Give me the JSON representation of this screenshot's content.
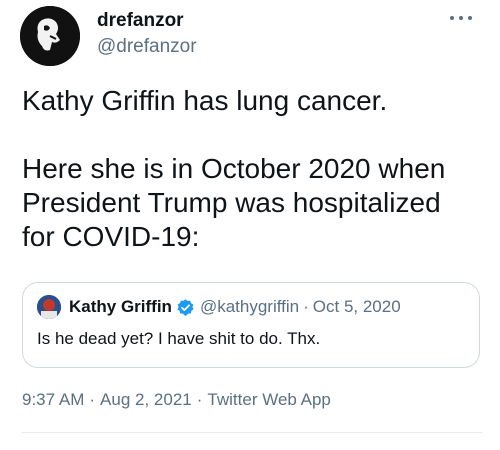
{
  "author": {
    "display_name": "drefanzor",
    "handle": "@drefanzor"
  },
  "tweet": {
    "lines": [
      "Kathy Griffin has lung cancer.",
      "",
      "Here she is in October 2020 when",
      "President Trump was hospitalized",
      "for COVID-19:"
    ]
  },
  "quoted_tweet": {
    "display_name": "Kathy Griffin",
    "handle": "@kathygriffin",
    "separator": "·",
    "date": "Oct 5, 2020",
    "text": "Is he dead yet? I have shit to do. Thx.",
    "verified_icon": "verified-badge-icon"
  },
  "meta": {
    "time": "9:37 AM",
    "separator": "·",
    "date": "Aug 2, 2021",
    "source": "Twitter Web App"
  },
  "icons": {
    "more": "more-horizontal-icon"
  },
  "colors": {
    "text": "#0f1419",
    "secondary": "#5b7083",
    "verified": "#1d9bf0",
    "border": "#cfd9de"
  }
}
